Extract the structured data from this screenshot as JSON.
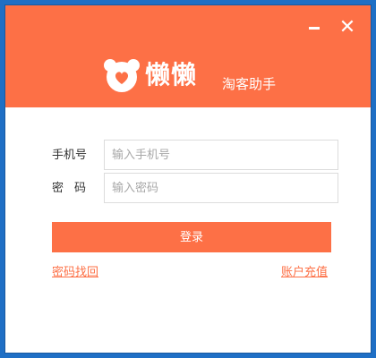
{
  "window": {
    "minimize_icon": "minimize-icon",
    "close_icon": "close-icon",
    "close_glyph": "✕"
  },
  "header": {
    "brand": "懒懒",
    "subtitle": "淘客助手",
    "logo_icon": "bear-logo-icon"
  },
  "form": {
    "phone_label": "手机号",
    "phone_placeholder": "输入手机号",
    "phone_value": "",
    "password_label": "密码",
    "password_placeholder": "输入密码",
    "password_value": ""
  },
  "actions": {
    "login_label": "登录",
    "forgot_label": "密码找回",
    "recharge_label": "账户充值"
  },
  "colors": {
    "accent": "#fd7046",
    "desktop": "#1f6fc5"
  }
}
